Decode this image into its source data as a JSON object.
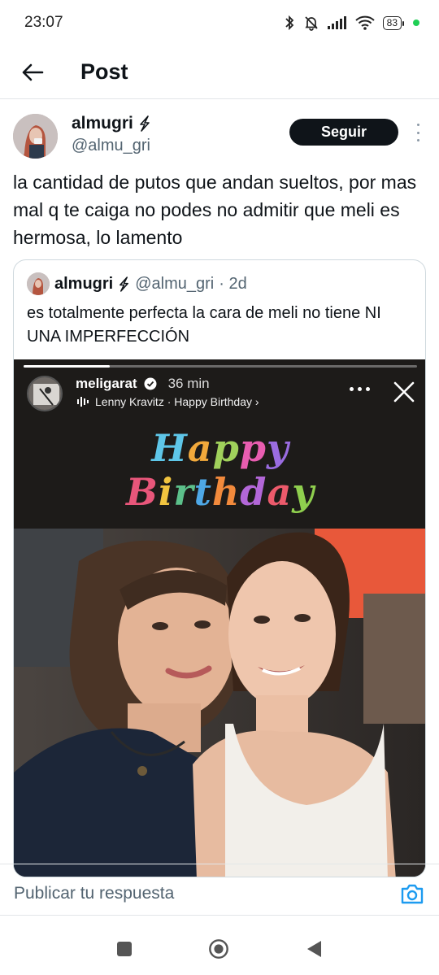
{
  "status_bar": {
    "time": "23:07",
    "battery": "83",
    "icons": [
      "bluetooth-icon",
      "bell-muted-icon",
      "signal-icon",
      "wifi-icon",
      "battery-icon"
    ]
  },
  "header": {
    "title": "Post"
  },
  "post": {
    "author_name": "almugri",
    "author_handle": "@almu_gri",
    "follow_label": "Seguir",
    "text": "la cantidad de putos que andan sueltos, por mas mal q te caiga no podes no admitir que meli es hermosa, lo lamento"
  },
  "quote": {
    "author_name": "almugri",
    "author_handle": "@almu_gri",
    "age": "· 2d",
    "text": "es totalmente perfecta la cara de meli no tiene NI UNA IMPERFECCIÓN",
    "story": {
      "username": "meligarat",
      "time": "36 min",
      "music": "Lenny Kravitz · Happy Birthday ›",
      "happy": [
        "H",
        "a",
        "p",
        "p",
        "y"
      ],
      "birthday": [
        "B",
        "i",
        "r",
        "t",
        "h",
        "d",
        "a",
        "y"
      ],
      "happy_colors": [
        "#5ec6e8",
        "#f2a93b",
        "#a0d15b",
        "#e85db0",
        "#9a6ce0"
      ],
      "birthday_colors": [
        "#e8567a",
        "#f1c43f",
        "#5cc08a",
        "#4ea8e6",
        "#f28a3c",
        "#b367d8",
        "#ec5a6b",
        "#8fcf4e"
      ],
      "progress": 0.22
    }
  },
  "reply": {
    "placeholder": "Publicar tu respuesta"
  },
  "colors": {
    "text_primary": "#0f1419",
    "text_secondary": "#536471",
    "accent": "#1d9bf0",
    "follow_bg": "#0f1419"
  }
}
